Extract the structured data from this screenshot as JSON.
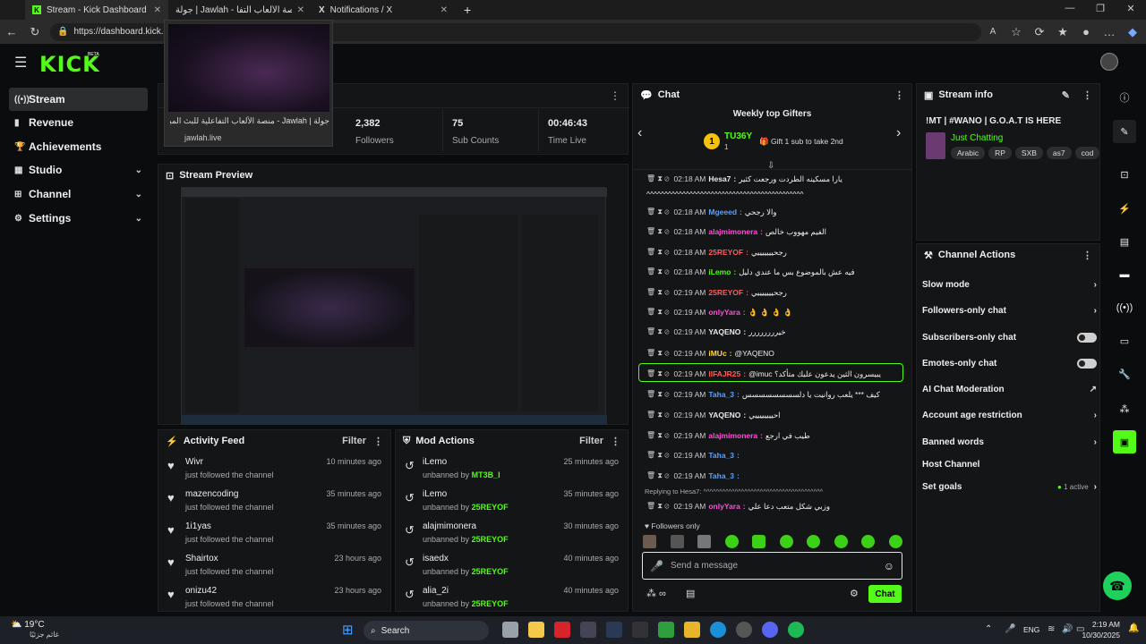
{
  "browser": {
    "tabs": [
      {
        "label": "Stream - Kick Dashboard",
        "active": true
      },
      {
        "label": "جولة | Jawlah - منصة الألعاب التفا...",
        "active": false
      },
      {
        "label": "Notifications / X",
        "active": false
      }
    ],
    "url": "https://dashboard.kick.com",
    "preview": {
      "title": "جولة | Jawlah - منصة الألعاب التفاعلية للبث المباشر",
      "site": "jawlah.live"
    }
  },
  "brand": {
    "logo": "KICK",
    "beta": "BETA",
    "accent": "#53fc18"
  },
  "sidebar": {
    "items": [
      {
        "label": "Stream",
        "icon": "broadcast-icon"
      },
      {
        "label": "Revenue",
        "icon": "bar-chart-icon"
      },
      {
        "label": "Achievements",
        "icon": "trophy-icon"
      },
      {
        "label": "Studio",
        "icon": "studio-icon"
      },
      {
        "label": "Channel",
        "icon": "channel-icon"
      },
      {
        "label": "Settings",
        "icon": "gear-icon"
      }
    ]
  },
  "session": {
    "stats": [
      {
        "value": "2,382",
        "label": "Followers"
      },
      {
        "value": "75",
        "label": "Sub Counts"
      },
      {
        "value": "00:46:43",
        "label": "Time Live"
      }
    ]
  },
  "preview_panel": {
    "title": "Stream Preview"
  },
  "activity": {
    "title": "Activity Feed",
    "filter": "Filter",
    "items": [
      {
        "name": "Wivr",
        "desc": "just followed the channel",
        "time": "10 minutes ago"
      },
      {
        "name": "mazencoding",
        "desc": "just followed the channel",
        "time": "35 minutes ago"
      },
      {
        "name": "1i1yas",
        "desc": "just followed the channel",
        "time": "35 minutes ago"
      },
      {
        "name": "Shairtox",
        "desc": "just followed the channel",
        "time": "23 hours ago"
      },
      {
        "name": "onizu42",
        "desc": "just followed the channel",
        "time": "23 hours ago"
      }
    ]
  },
  "mod": {
    "title": "Mod Actions",
    "filter": "Filter",
    "by_label": "unbanned by",
    "items": [
      {
        "name": "iLemo",
        "by": "MT3B_I",
        "time": "25 minutes ago"
      },
      {
        "name": "iLemo",
        "by": "25REYOF",
        "time": "35 minutes ago"
      },
      {
        "name": "alajmimonera",
        "by": "25REYOF",
        "time": "30 minutes ago"
      },
      {
        "name": "isaedx",
        "by": "25REYOF",
        "time": "40 minutes ago"
      },
      {
        "name": "alia_2i",
        "by": "25REYOF",
        "time": "40 minutes ago"
      }
    ]
  },
  "chat": {
    "title": "Chat",
    "gifters_title": "Weekly top Gifters",
    "top_gifter": {
      "rank": "1",
      "name": "TU36Y",
      "count": "1"
    },
    "gift_cta": "Gift 1 sub to take 2nd",
    "messages": [
      {
        "time": "02:18 AM",
        "user": "Hesa7",
        "color": "#eaeaea",
        "text": "يارا مسكينه الطردت ورجعت كثير"
      },
      {
        "time": "",
        "user": "",
        "color": "#eaeaea",
        "text": "^^^^^^^^^^^^^^^^^^^^^^^^^^^^^^^^^^^^^^^^^^^^"
      },
      {
        "time": "02:18 AM",
        "user": "Mgeeed",
        "color": "#5aa0ff",
        "text": "والا رجحي"
      },
      {
        "time": "02:18 AM",
        "user": "alajmimonera",
        "color": "#ff4fd8",
        "text": "الفيم مهووب خالص"
      },
      {
        "time": "02:18 AM",
        "user": "25REYOF",
        "color": "#ff5a5a",
        "text": "رجحيييييييي"
      },
      {
        "time": "02:18 AM",
        "user": "iLemo",
        "color": "#53fc18",
        "text": "فيه عش بالموضوع بس ما عندي دليل"
      },
      {
        "time": "02:19 AM",
        "user": "25REYOF",
        "color": "#ff5a5a",
        "text": "رجحيييييييي"
      },
      {
        "time": "02:19 AM",
        "user": "onlyYara",
        "color": "#ff4fd8",
        "text": "👌 👌 👌 👌"
      },
      {
        "time": "02:19 AM",
        "user": "YAQENO",
        "color": "#eaeaea",
        "text": "خيرررررررر"
      },
      {
        "time": "02:19 AM",
        "user": "iMUc",
        "color": "#ffd84a",
        "text": "@YAQENO"
      },
      {
        "time": "02:19 AM",
        "user": "IIFAJR25",
        "color": "#ff5a5a",
        "text": "@imuc يبيسرون الثين يدعون عليك متأكد؟"
      },
      {
        "time": "02:19 AM",
        "user": "Taha_3",
        "color": "#5aa0ff",
        "text": "كيف *** يلعب روانيت يا دلسسسسسسسس"
      },
      {
        "time": "02:19 AM",
        "user": "YAQENO",
        "color": "#eaeaea",
        "text": "احييييييييي"
      },
      {
        "time": "02:19 AM",
        "user": "alajmimonera",
        "color": "#ff4fd8",
        "text": "طيب في ارجع"
      },
      {
        "time": "02:19 AM",
        "user": "Taha_3",
        "color": "#5aa0ff",
        "text": ""
      },
      {
        "time": "02:19 AM",
        "user": "Taha_3",
        "color": "#5aa0ff",
        "text": ""
      },
      {
        "time": "02:19 AM",
        "user": "onlyYara",
        "color": "#ff4fd8",
        "text": "وزبي شكل متعب دعا علي"
      }
    ],
    "replying": "Replying to Hesa7: ^^^^^^^^^^^^^^^^^^^^^^^^^^^^^^^^^^^^^^",
    "followers_only": "Followers only",
    "input_placeholder": "Send a message",
    "send_label": "Chat"
  },
  "stream_info": {
    "title": "Stream info",
    "stream_title": "!MT | #WANO | G.O.A.T IS HERE",
    "category": "Just Chatting",
    "tags": [
      "Arabic",
      "RP",
      "SXB",
      "as7",
      "cod"
    ]
  },
  "channel_actions": {
    "title": "Channel Actions",
    "items": [
      {
        "label": "Slow mode",
        "control": "chevron"
      },
      {
        "label": "Followers-only chat",
        "control": "chevron"
      },
      {
        "label": "Subscribers-only chat",
        "control": "toggle"
      },
      {
        "label": "Emotes-only chat",
        "control": "toggle"
      },
      {
        "label": "AI Chat Moderation",
        "control": "external"
      },
      {
        "label": "Account age restriction",
        "control": "chevron"
      },
      {
        "label": "Banned words",
        "control": "chevron"
      },
      {
        "label": "Host Channel",
        "control": "none"
      },
      {
        "label": "Set goals",
        "control": "chevron",
        "status": "1 active"
      }
    ]
  },
  "taskbar": {
    "weather_temp": "19°C",
    "weather_desc": "غائم جزئيًا",
    "search": "Search",
    "lang": "ENG",
    "time": "2:19 AM",
    "date": "10/30/2025"
  }
}
